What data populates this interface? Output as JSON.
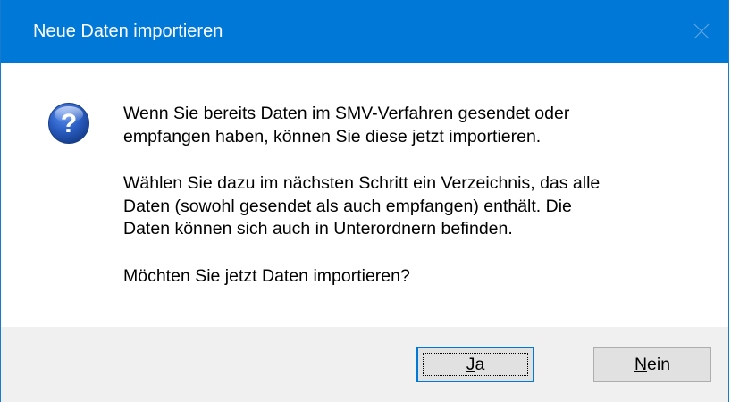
{
  "dialog": {
    "title": "Neue Daten importieren",
    "close_label": "✕",
    "icon": "question-icon",
    "message": {
      "paragraph1_line1": "Wenn Sie bereits Daten im SMV-Verfahren gesendet oder",
      "paragraph1_line2": "empfangen haben, können Sie diese jetzt importieren.",
      "paragraph2_line1": "Wählen Sie dazu im nächsten Schritt ein Verzeichnis, das alle",
      "paragraph2_line2": "Daten (sowohl gesendet als auch empfangen) enthält. Die",
      "paragraph2_line3": "Daten können sich auch in Unterordnern befinden.",
      "paragraph3_line1": "Möchten Sie jetzt Daten importieren?"
    },
    "buttons": {
      "yes_accel": "J",
      "yes_rest": "a",
      "no_accel": "N",
      "no_rest": "ein"
    }
  },
  "colors": {
    "titlebar": "#0078d7",
    "footer": "#f0f0f0",
    "button_face": "#e1e1e1"
  }
}
